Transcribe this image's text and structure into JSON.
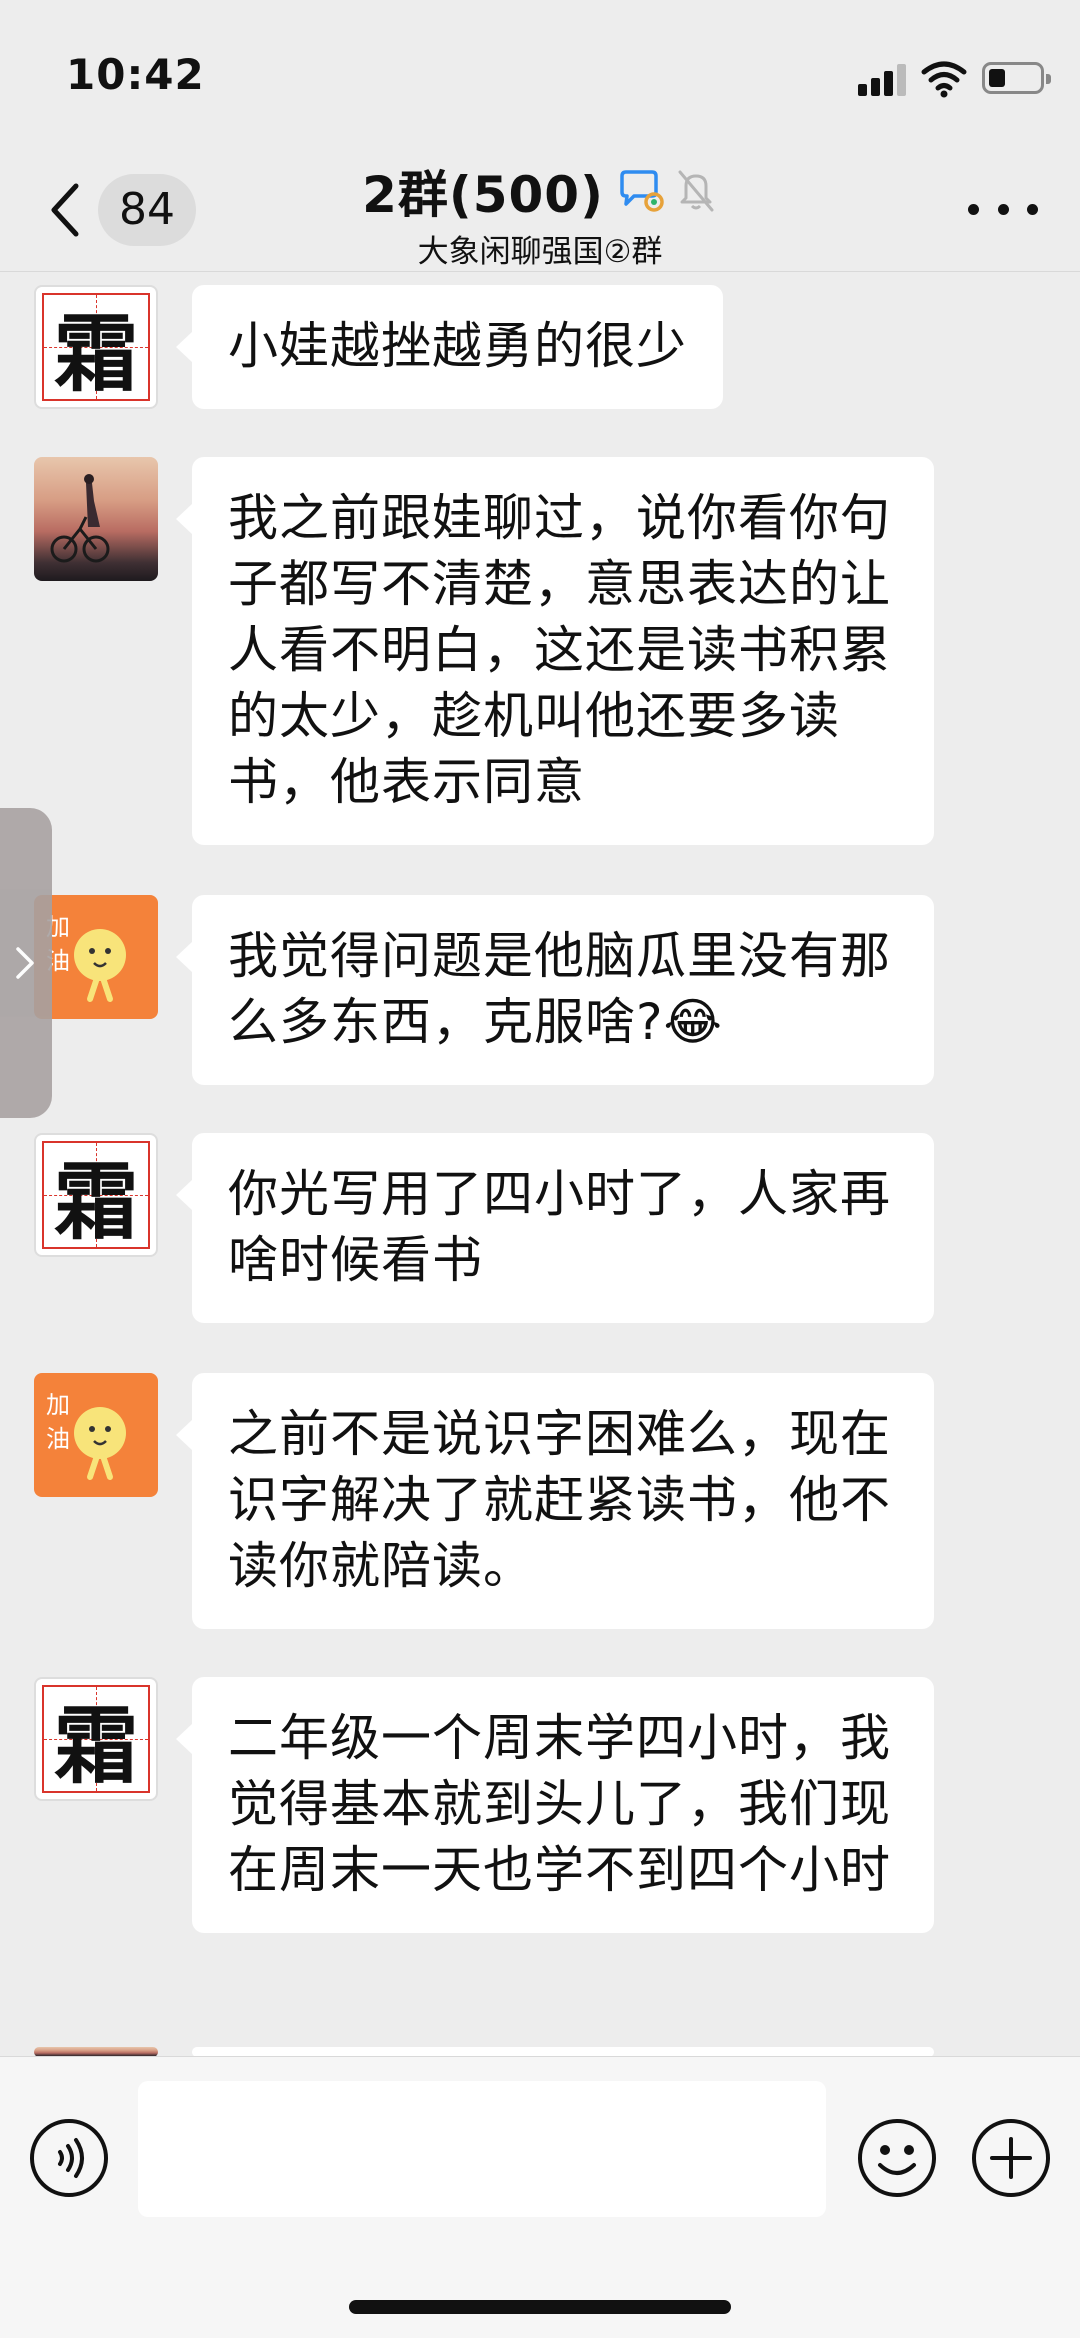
{
  "status_bar": {
    "time": "10:42"
  },
  "nav": {
    "unread_count": "84",
    "title": "2群(500)",
    "subtitle": "大象闲聊强国②群",
    "more_icon": "more-dots-icon",
    "back_icon": "chevron-left-icon"
  },
  "messages": [
    {
      "avatar": "shuang",
      "text": "小娃越挫越勇的很少"
    },
    {
      "avatar": "photo",
      "text": "我之前跟娃聊过，说你看你句子都写不清楚，意思表达的让人看不明白，这还是读书积累的太少，趁机叫他还要多读书，他表示同意"
    },
    {
      "avatar": "orange",
      "text": "我觉得问题是他脑瓜里没有那么多东西，克服啥?",
      "emoji": "😂"
    },
    {
      "avatar": "shuang",
      "text": "你光写用了四小时了，人家再啥时候看书"
    },
    {
      "avatar": "orange",
      "text": "之前不是说识字困难么，现在识字解决了就赶紧读书，他不读你就陪读。"
    },
    {
      "avatar": "shuang",
      "text": "二年级一个周末学四小时，我觉得基本就到头儿了，我们现在周末一天也学不到四个小时"
    }
  ],
  "avatars": {
    "shuang_char": "霜",
    "orange_text_1": "加",
    "orange_text_2": "油"
  },
  "input": {
    "value": "",
    "voice_icon": "voice-icon",
    "emoji_icon": "emoji-icon",
    "plus_icon": "plus-icon"
  },
  "colors": {
    "background": "#ededed",
    "bubble": "#ffffff",
    "orange_avatar": "#f4823a",
    "grid_red": "#d9342b"
  }
}
